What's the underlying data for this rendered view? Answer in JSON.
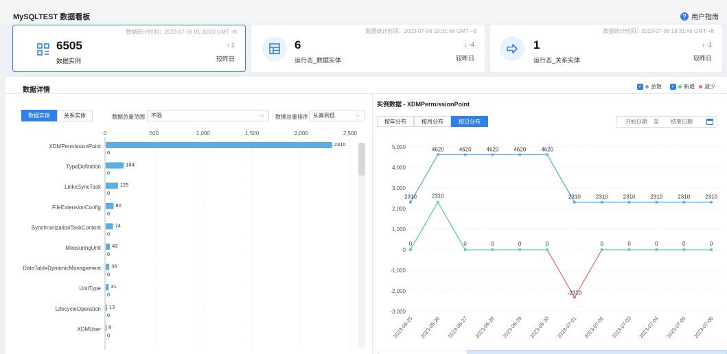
{
  "app": {
    "title": "MySQLTEST 数据看板",
    "help": "用户指南"
  },
  "cards": [
    {
      "time": "数据统计时间：2023-07-06 01:30:00 GMT +8",
      "value": "6505",
      "label": "数据实例",
      "delta": "↑ 1",
      "direction": "up",
      "compare": "较昨日",
      "icon": "grid-icon"
    },
    {
      "time": "数据统计时间：2023-07-06 19:31:46 GMT +8",
      "value": "6",
      "label": "运行态_数据实体",
      "delta": "↓ -4",
      "direction": "down",
      "compare": "较昨日",
      "icon": "table-icon"
    },
    {
      "time": "数据统计时间：2023-07-06 19:31:46 GMT +8",
      "value": "1",
      "label": "运行态_关系实体",
      "delta": "↓ -1",
      "direction": "down",
      "compare": "较昨日",
      "icon": "arrow-right-icon"
    }
  ],
  "detail": {
    "title": "数据详情",
    "legend": [
      {
        "label": "总数",
        "color": "#5dade2",
        "check": "✓"
      },
      {
        "label": "新增",
        "color": "#58d68d",
        "check": "✓"
      },
      {
        "label": "减少",
        "color": "#ec7063"
      }
    ],
    "tabs": [
      "数据实体",
      "关系实体"
    ],
    "range_label": "数据总量范围",
    "range_value": "不限",
    "sort_label": "数据总量排序",
    "sort_value": "从高到低"
  },
  "instance": {
    "title": "实例数据 - XDMPermissionPoint",
    "tabs": [
      "按年分布",
      "按月分布",
      "按日分布"
    ],
    "start_placeholder": "开始日期",
    "sep": "至",
    "end_placeholder": "结束日期"
  },
  "colors": {
    "accent": "#2f80ed",
    "total": "#5dade2",
    "added": "#58d68d",
    "reduced": "#ec7063"
  },
  "chart_data": [
    {
      "type": "bar",
      "orientation": "horizontal",
      "categories": [
        "XDMPermissionPoint",
        "TypeDefinition",
        "LinkxSyncTask",
        "FileExtensionConfig",
        "SynchronizationTaskContent",
        "MeasuringUnit",
        "DataTableDynamicManagement",
        "UnitType",
        "LifecycleOperation",
        "XDMUser"
      ],
      "series": [
        {
          "values": [
            2310,
            184,
            125,
            80,
            74,
            43,
            36,
            31,
            13,
            8
          ]
        },
        {
          "values": [
            0,
            0,
            0,
            0,
            0,
            0,
            0,
            0,
            0,
            0
          ]
        }
      ],
      "xticks": [
        "0",
        "500",
        "1,000",
        "1,500",
        "2,000",
        "2,500"
      ],
      "xlim": [
        0,
        2500
      ],
      "grid": true
    },
    {
      "type": "line",
      "x": [
        "2023-06-25",
        "2023-06-26",
        "2023-06-27",
        "2023-06-28",
        "2023-06-29",
        "2023-06-30",
        "2023-07-01",
        "2023-07-02",
        "2023-07-03",
        "2023-07-04",
        "2023-07-05",
        "2023-07-06"
      ],
      "series": [
        {
          "values": [
            2310,
            4620,
            4620,
            4620,
            4620,
            4620,
            2310,
            2310,
            2310,
            2310,
            2310,
            2310
          ]
        },
        {
          "values": [
            0,
            2310,
            0,
            0,
            0,
            0,
            -2310,
            0,
            0,
            0,
            0,
            0
          ]
        }
      ],
      "labels_total": [
        "2310",
        "4620",
        "4620",
        "4620",
        "4620",
        "4620",
        "2310",
        "2310",
        "2310",
        "2310",
        "2310",
        "2310"
      ],
      "labels_change": [
        "0",
        "2310",
        "0",
        "0",
        "0",
        "0",
        "-2310",
        "0",
        "0",
        "0",
        "0",
        "0"
      ],
      "yticks": [
        "5,000",
        "4,000",
        "3,000",
        "2,000",
        "1,000",
        "0",
        "-1,000",
        "-2,000",
        "-3,000"
      ],
      "ylim": [
        -3000,
        5000
      ],
      "grid": true
    }
  ]
}
